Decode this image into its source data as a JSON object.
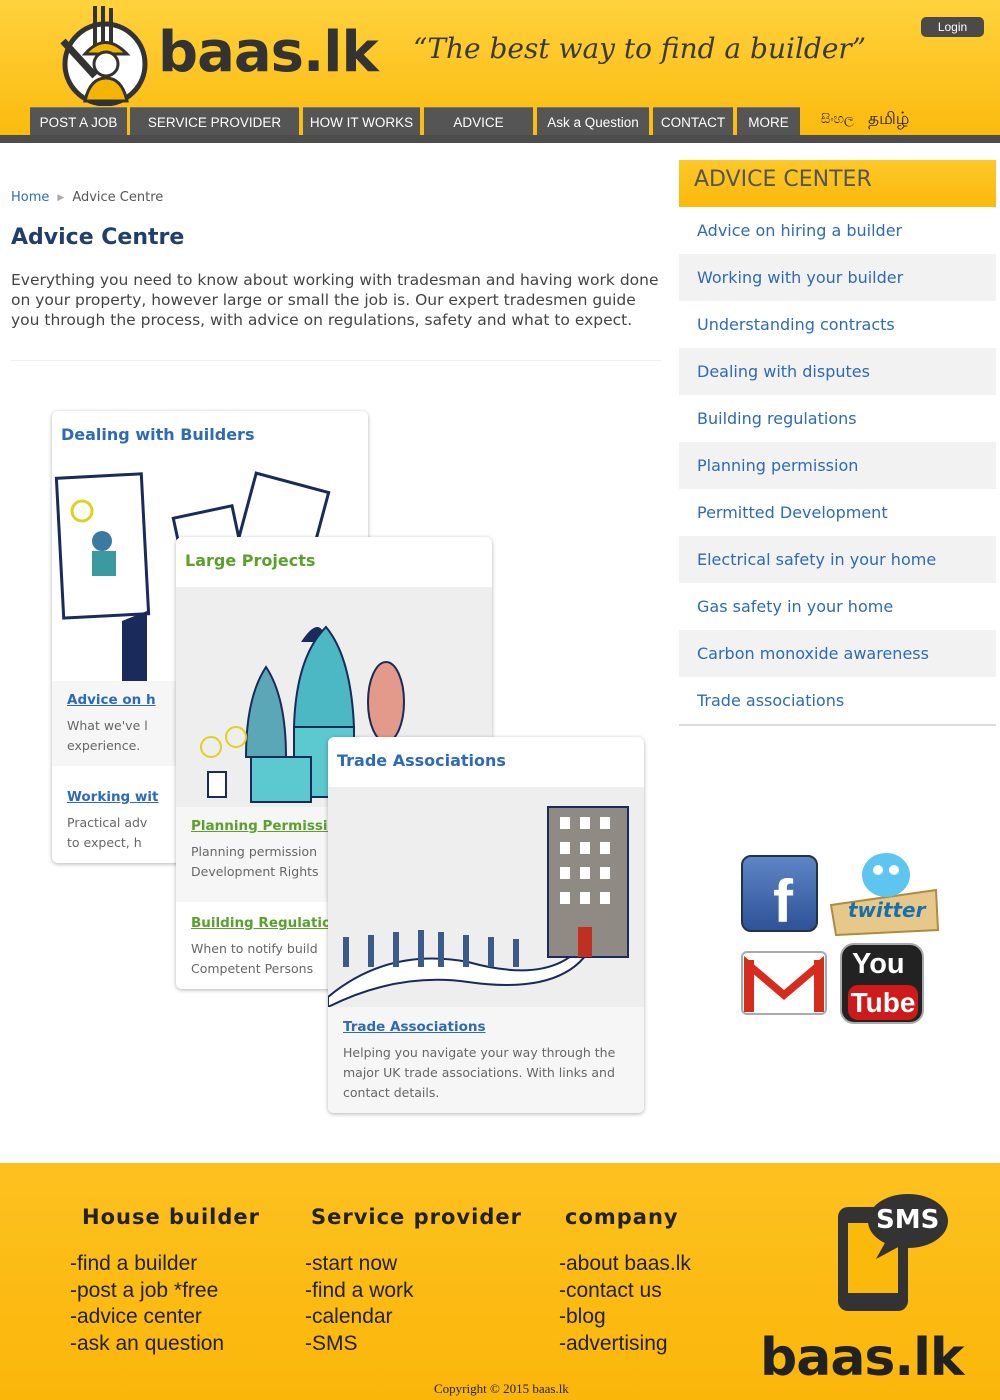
{
  "header": {
    "logo_text": "baas.lk",
    "tagline": "“The best way to find a builder”",
    "login_label": "Login",
    "nav": [
      {
        "label": "POST A JOB"
      },
      {
        "label": "SERVICE PROVIDER START"
      },
      {
        "label": "HOW IT WORKS"
      },
      {
        "label": "ADVICE CENTER"
      },
      {
        "label": "Ask a Question"
      },
      {
        "label": "CONTACT"
      },
      {
        "label": "MORE"
      }
    ],
    "languages": [
      "සිංහල",
      "தமிழ்"
    ]
  },
  "breadcrumb": {
    "home": "Home",
    "current": "Advice Centre"
  },
  "main": {
    "title": "Advice Centre",
    "intro": "Everything you need to know about working with tradesman and having work done on your property, however large or small the job is. Our expert tradesmen guide you through the process, with advice on regulations, safety and what to expect.",
    "cards": [
      {
        "title": "Dealing with Builders",
        "links": [
          {
            "label": "Advice on h",
            "desc": "What we've l experience."
          },
          {
            "label": "Working wit",
            "desc": "Practical adv to expect, h"
          }
        ]
      },
      {
        "title": "Large Projects",
        "links": [
          {
            "label": "Planning Permissio",
            "desc": "Planning permission Development Rights"
          },
          {
            "label": "Building Regulatio",
            "desc": "When to notify build Competent Persons"
          }
        ]
      },
      {
        "title": "Trade Associations",
        "links": [
          {
            "label": "Trade Associations",
            "desc": "Helping you navigate your way through the major UK trade associations. With links and contact details."
          }
        ]
      }
    ]
  },
  "sidebar": {
    "heading": "ADVICE CENTER",
    "items": [
      "Advice on hiring a builder",
      "Working with your builder",
      "Understanding contracts",
      "Dealing with disputes",
      "Building regulations",
      "Planning permission",
      "Permitted Development",
      "Electrical safety in your home",
      "Gas safety in your home",
      "Carbon monoxide awareness",
      "Trade associations"
    ]
  },
  "social": {
    "facebook": "f",
    "twitter": "twitter",
    "youtube_top": "You",
    "youtube_bottom": "Tube"
  },
  "footer": {
    "columns": [
      {
        "heading": "House builder",
        "items": [
          "-find a builder",
          "-post a job *free",
          "-advice center",
          "-ask an question"
        ]
      },
      {
        "heading": "Service provider",
        "items": [
          "-start now",
          "-find a work",
          "-calendar",
          "-SMS"
        ]
      },
      {
        "heading": "company",
        "items": [
          "-about baas.lk",
          "-contact us",
          "-blog",
          "-advertising"
        ]
      }
    ],
    "sms_label": "SMS",
    "logo_text": "baas.lk",
    "copyright": "Copyright © 2015 baas.lk"
  },
  "colors": {
    "accent": "#fbb90c",
    "link": "#2d6bb5",
    "green": "#5aa02c",
    "title": "#1f3d6e"
  }
}
